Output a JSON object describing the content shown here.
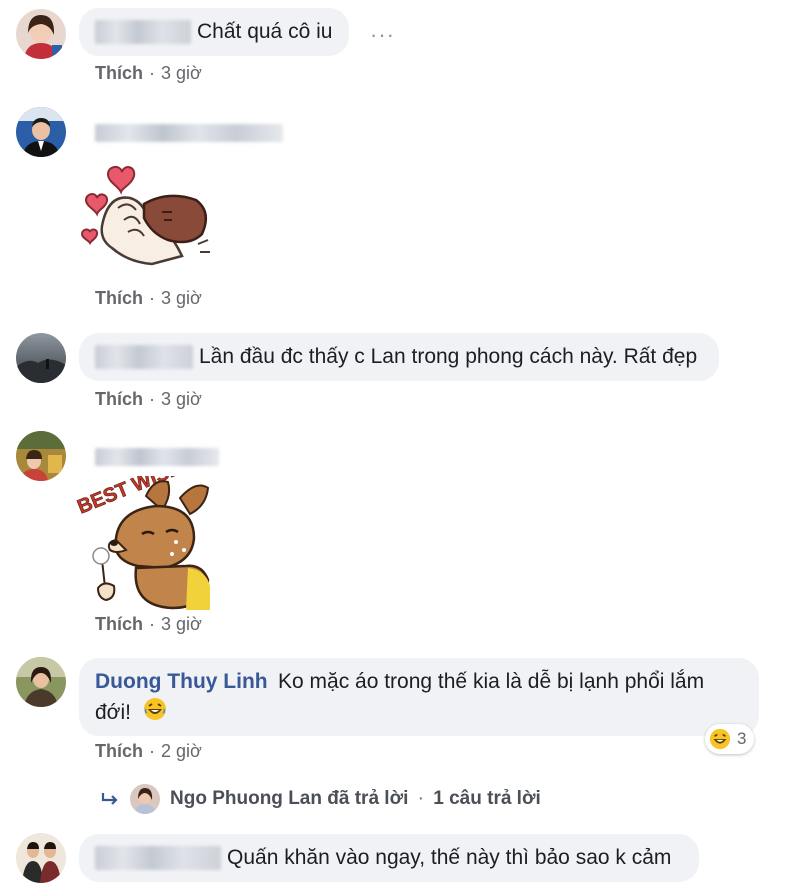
{
  "comments": [
    {
      "text": "Chất quá cô iu",
      "like": "Thích",
      "time": "3 giờ"
    },
    {
      "like": "Thích",
      "time": "3 giờ"
    },
    {
      "text": "Lần đầu đc thấy c Lan trong phong cách này. Rất đẹp",
      "like": "Thích",
      "time": "3 giờ"
    },
    {
      "sticker_text": "BEST WISHES",
      "like": "Thích",
      "time": "3 giờ"
    },
    {
      "author": "Duong Thuy Linh",
      "text_line1": "Ko mặc áo trong thế kia là dễ bị lạnh phổi lắm",
      "text_line2": "đới!",
      "like": "Thích",
      "time": "2 giờ",
      "reaction_count": "3"
    },
    {
      "text": "Quấn khăn vào ngay, thế này thì bảo sao k cảm"
    }
  ],
  "reply": {
    "author": "Ngo Phuong Lan",
    "action": "đã trả lời",
    "sep": "·",
    "count": "1 câu trả lời"
  },
  "more_label": "···",
  "separator": "·",
  "icons": {
    "more": "more-options-icon",
    "reply_arrow": "reply-arrow-icon",
    "emoji": "laughing-emoji-icon",
    "heart": "heart-icon"
  },
  "colors": {
    "link": "#385898",
    "bubble": "#f0f2f5",
    "meta": "#65676b"
  }
}
